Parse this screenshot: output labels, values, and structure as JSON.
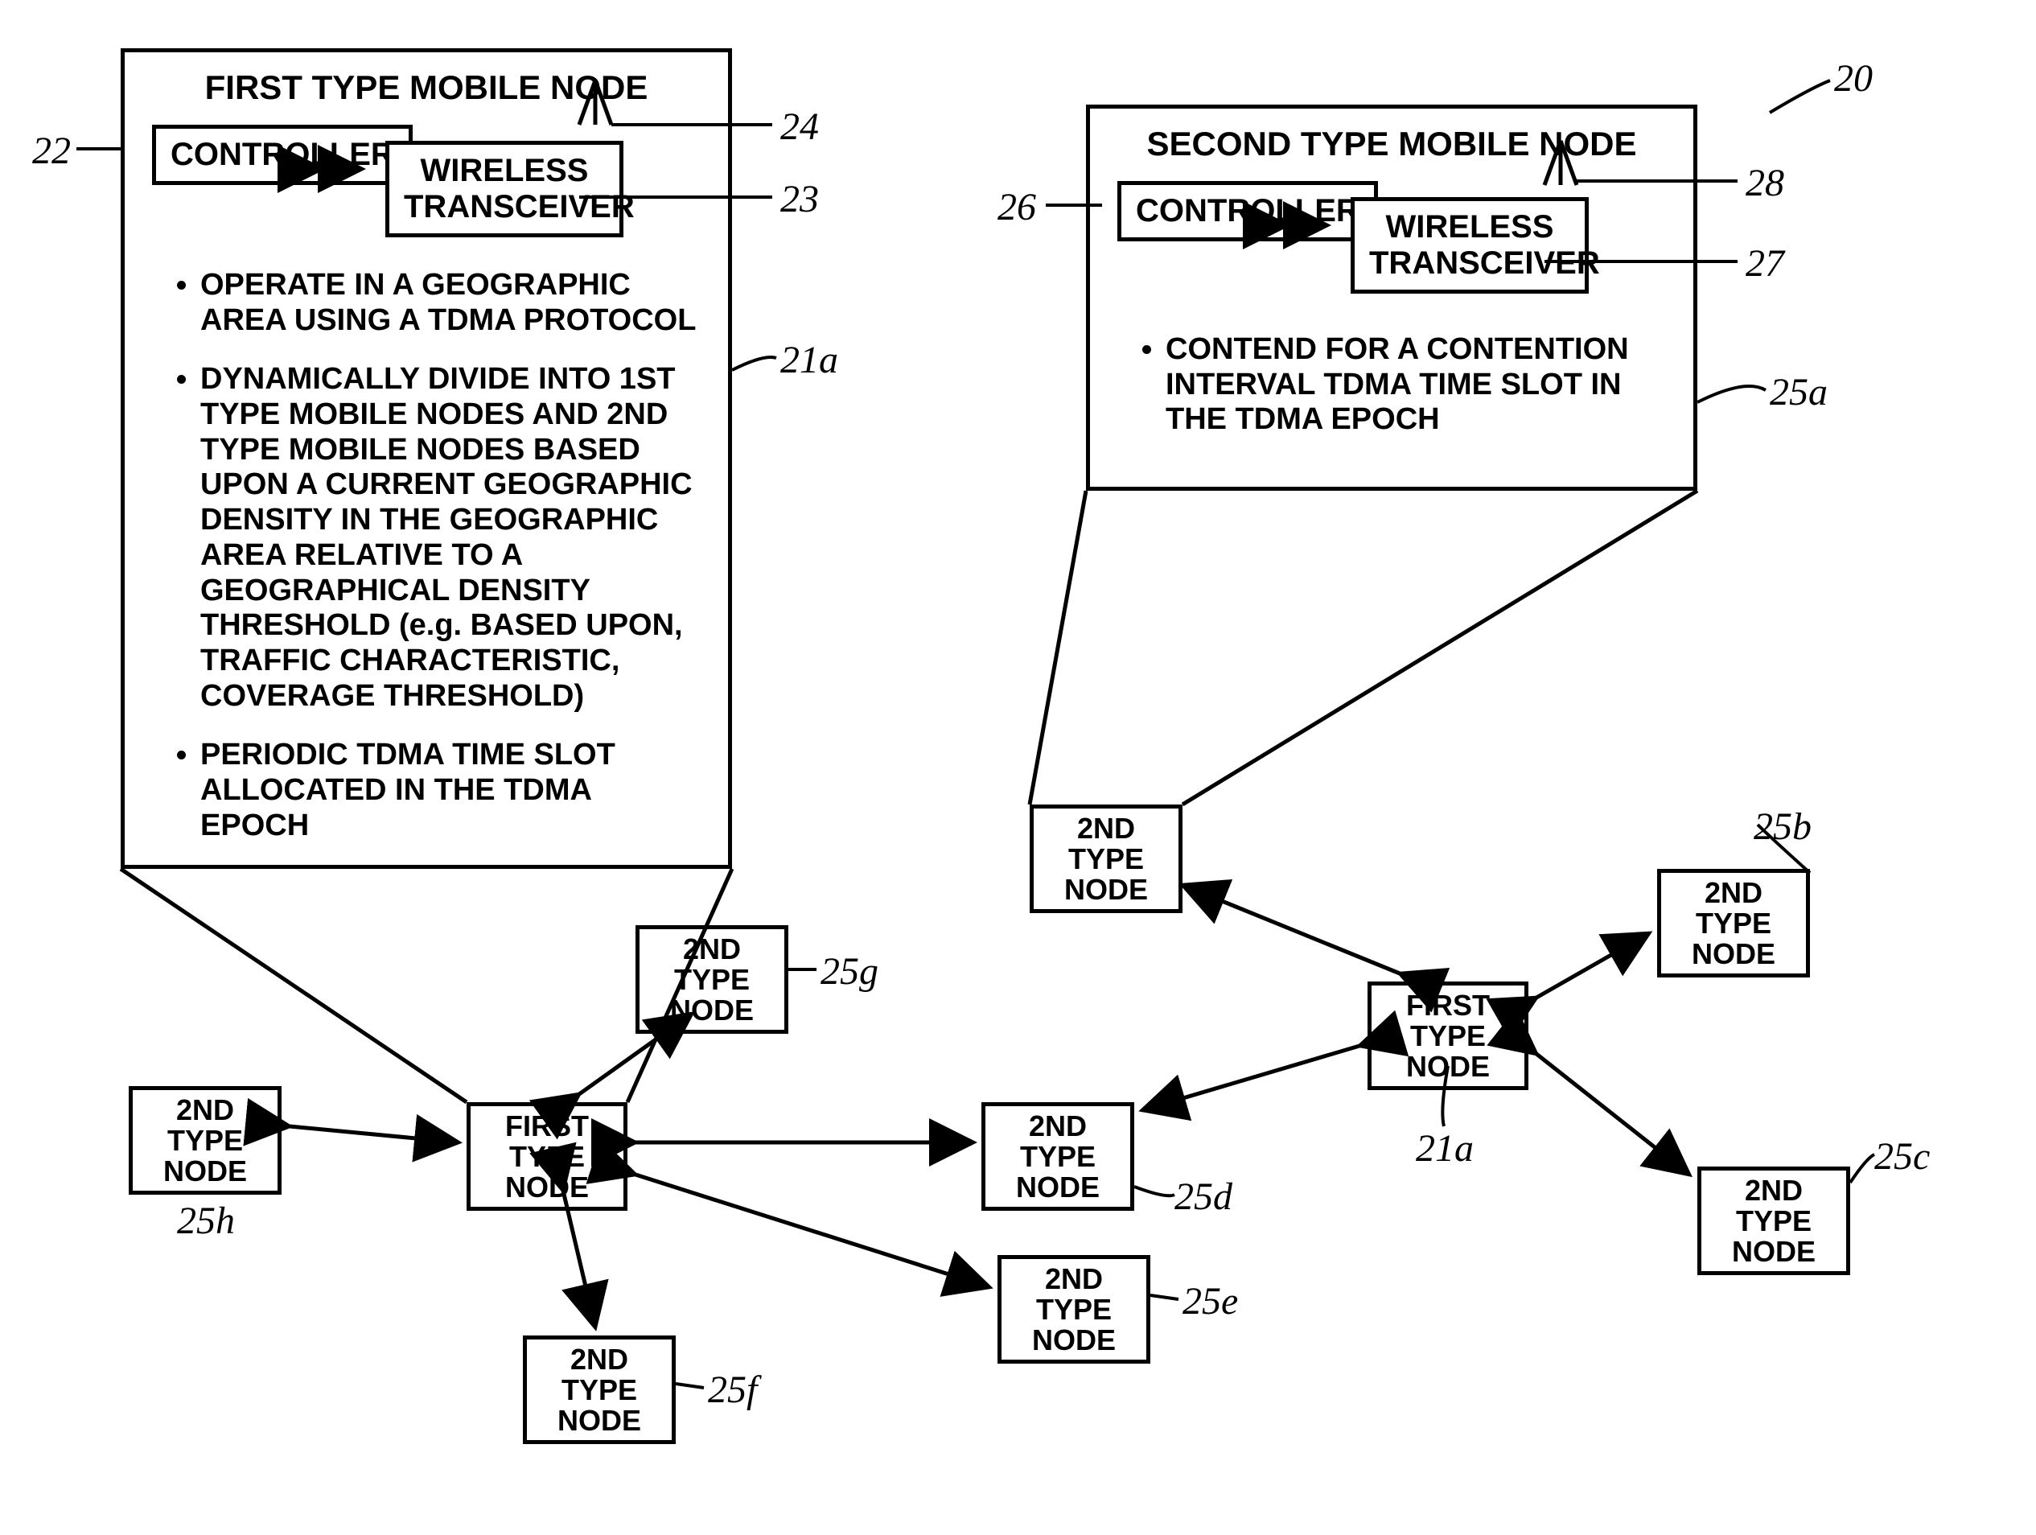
{
  "refs": {
    "r20": "20",
    "r21a_left": "21a",
    "r21a_right": "21a",
    "r22": "22",
    "r23": "23",
    "r24": "24",
    "r25a": "25a",
    "r25b": "25b",
    "r25c": "25c",
    "r25d": "25d",
    "r25e": "25e",
    "r25f": "25f",
    "r25g": "25g",
    "r25h": "25h",
    "r26": "26",
    "r27": "27",
    "r28": "28"
  },
  "first_detail": {
    "title": "FIRST TYPE MOBILE NODE",
    "controller": "CONTROLLER",
    "transceiver_l1": "WIRELESS",
    "transceiver_l2": "TRANSCEIVER",
    "b1": "OPERATE IN A GEOGRAPHIC AREA USING A TDMA PROTOCOL",
    "b2": "DYNAMICALLY DIVIDE INTO 1ST TYPE MOBILE NODES AND 2ND TYPE MOBILE NODES BASED UPON A CURRENT GEOGRAPHIC DENSITY IN THE GEOGRAPHIC AREA RELATIVE TO A GEOGRAPHICAL DENSITY THRESHOLD (e.g. BASED UPON, TRAFFIC CHARACTERISTIC, COVERAGE THRESHOLD)",
    "b3": "PERIODIC TDMA TIME SLOT ALLOCATED IN THE TDMA EPOCH"
  },
  "second_detail": {
    "title": "SECOND TYPE MOBILE NODE",
    "controller": "CONTROLLER",
    "transceiver_l1": "WIRELESS",
    "transceiver_l2": "TRANSCEIVER",
    "b1": "CONTEND FOR A CONTENTION INTERVAL TDMA TIME SLOT IN THE TDMA EPOCH"
  },
  "nodes": {
    "first_left_l1": "FIRST TYPE",
    "first_left_l2": "NODE",
    "first_right_l1": "FIRST TYPE",
    "first_right_l2": "NODE",
    "n25a_l1": "2ND TYPE",
    "n25a_l2": "NODE",
    "n25b_l1": "2ND TYPE",
    "n25b_l2": "NODE",
    "n25c_l1": "2ND TYPE",
    "n25c_l2": "NODE",
    "n25d_l1": "2ND TYPE",
    "n25d_l2": "NODE",
    "n25e_l1": "2ND TYPE",
    "n25e_l2": "NODE",
    "n25f_l1": "2ND TYPE",
    "n25f_l2": "NODE",
    "n25g_l1": "2ND TYPE",
    "n25g_l2": "NODE",
    "n25h_l1": "2ND TYPE",
    "n25h_l2": "NODE"
  }
}
